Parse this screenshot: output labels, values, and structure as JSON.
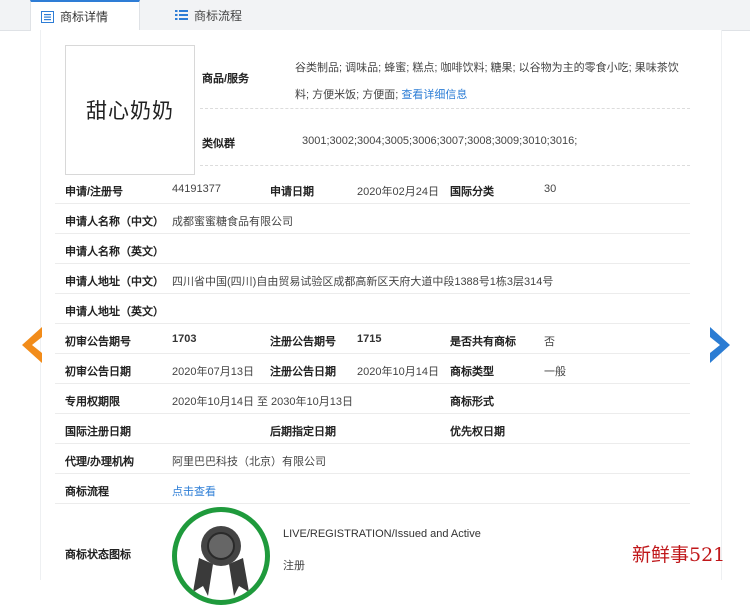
{
  "tabs": [
    {
      "label": "商标详情",
      "icon": "document-icon",
      "active": true
    },
    {
      "label": "商标流程",
      "icon": "list-icon",
      "active": false
    }
  ],
  "logo": {
    "text": "甜心奶奶"
  },
  "goods": {
    "label": "商品/服务",
    "value": "谷类制品; 调味品; 蜂蜜; 糕点; 咖啡饮料; 糖果; 以谷物为主的零食小吃; 果味茶饮料; 方便米饭; 方便面;",
    "link": "查看详细信息"
  },
  "similar_group": {
    "label": "类似群",
    "value": "3001;3002;3004;3005;3006;3007;3008;3009;3010;3016;"
  },
  "fields": {
    "reg_no_label": "申请/注册号",
    "reg_no": "44191377",
    "app_date_label": "申请日期",
    "app_date": "2020年02月24日",
    "intl_class_label": "国际分类",
    "intl_class": "30",
    "applicant_cn_label": "申请人名称（中文）",
    "applicant_cn": "成都蜜蜜糖食品有限公司",
    "applicant_en_label": "申请人名称（英文）",
    "applicant_en": "",
    "address_cn_label": "申请人地址（中文）",
    "address_cn": "四川省中国(四川)自由贸易试验区成都高新区天府大道中段1388号1栋3层314号",
    "address_en_label": "申请人地址（英文）",
    "address_en": "",
    "prelim_no_label": "初审公告期号",
    "prelim_no": "1703",
    "reg_pub_no_label": "注册公告期号",
    "reg_pub_no": "1715",
    "shared_label": "是否共有商标",
    "shared": "否",
    "prelim_date_label": "初审公告日期",
    "prelim_date": "2020年07月13日",
    "reg_pub_date_label": "注册公告日期",
    "reg_pub_date": "2020年10月14日",
    "tm_type_label": "商标类型",
    "tm_type": "一般",
    "exclusive_label": "专用权期限",
    "exclusive": "2020年10月14日 至 2030年10月13日",
    "tm_form_label": "商标形式",
    "tm_form": "",
    "intl_reg_date_label": "国际注册日期",
    "intl_reg_date": "",
    "later_date_label": "后期指定日期",
    "later_date": "",
    "priority_date_label": "优先权日期",
    "priority_date": "",
    "agent_label": "代理/办理机构",
    "agent": "阿里巴巴科技（北京）有限公司",
    "process_label": "商标流程",
    "process_link": "点击查看",
    "status_label": "商标状态图标",
    "status_en": "LIVE/REGISTRATION/Issued and Active",
    "status_cn": "注册"
  },
  "watermark_text": "新鲜事521",
  "colors": {
    "accent": "#2d7ed6",
    "arrow_left": "#f28c1a",
    "arrow_right": "#2b7cd3",
    "seal_ring": "#1f9a3c",
    "watermark": "#c0171a"
  }
}
